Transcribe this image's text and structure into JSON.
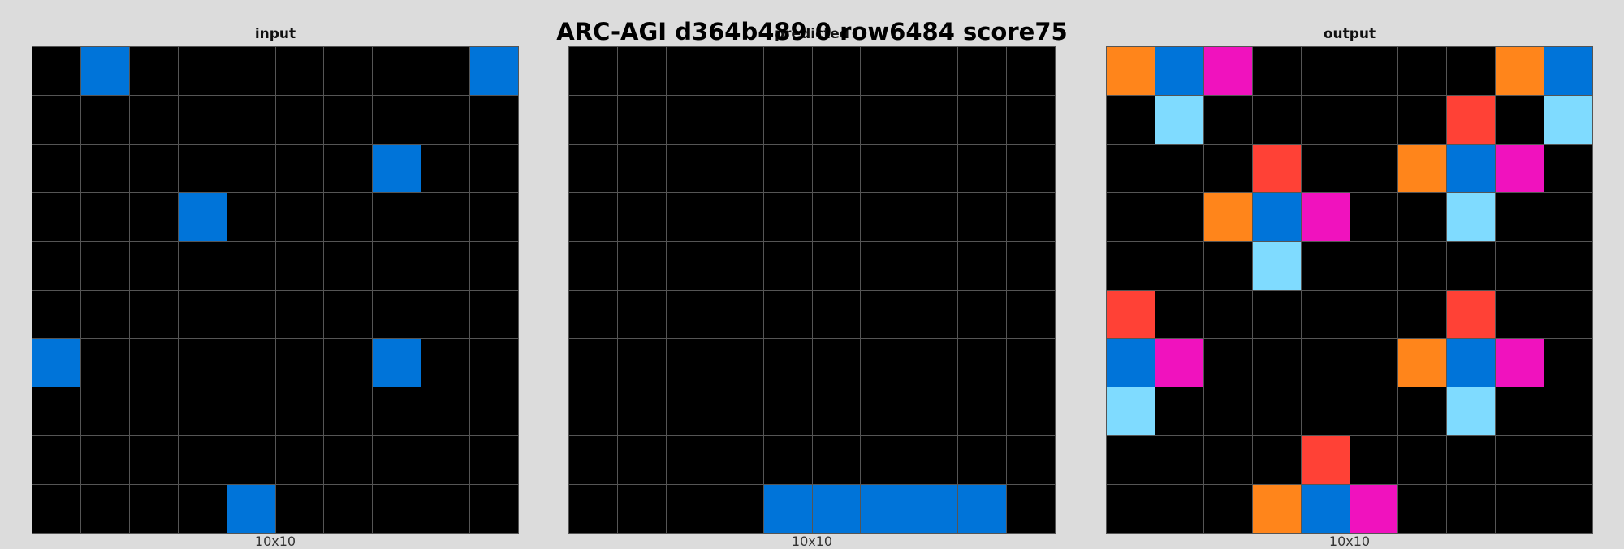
{
  "title": "ARC-AGI d364b489 0 row6484 score75",
  "palette": {
    "0": "#000000",
    "1": "#0074d9",
    "2": "#ff4136",
    "6": "#f012be",
    "7": "#ff851b",
    "8": "#7fdbff"
  },
  "panels": [
    {
      "label": "input",
      "size": "10x10",
      "grid": [
        [
          0,
          1,
          0,
          0,
          0,
          0,
          0,
          0,
          0,
          1
        ],
        [
          0,
          0,
          0,
          0,
          0,
          0,
          0,
          0,
          0,
          0
        ],
        [
          0,
          0,
          0,
          0,
          0,
          0,
          0,
          1,
          0,
          0
        ],
        [
          0,
          0,
          0,
          1,
          0,
          0,
          0,
          0,
          0,
          0
        ],
        [
          0,
          0,
          0,
          0,
          0,
          0,
          0,
          0,
          0,
          0
        ],
        [
          0,
          0,
          0,
          0,
          0,
          0,
          0,
          0,
          0,
          0
        ],
        [
          1,
          0,
          0,
          0,
          0,
          0,
          0,
          1,
          0,
          0
        ],
        [
          0,
          0,
          0,
          0,
          0,
          0,
          0,
          0,
          0,
          0
        ],
        [
          0,
          0,
          0,
          0,
          0,
          0,
          0,
          0,
          0,
          0
        ],
        [
          0,
          0,
          0,
          0,
          1,
          0,
          0,
          0,
          0,
          0
        ]
      ]
    },
    {
      "label": "predicted",
      "size": "10x10",
      "grid": [
        [
          0,
          0,
          0,
          0,
          0,
          0,
          0,
          0,
          0,
          0
        ],
        [
          0,
          0,
          0,
          0,
          0,
          0,
          0,
          0,
          0,
          0
        ],
        [
          0,
          0,
          0,
          0,
          0,
          0,
          0,
          0,
          0,
          0
        ],
        [
          0,
          0,
          0,
          0,
          0,
          0,
          0,
          0,
          0,
          0
        ],
        [
          0,
          0,
          0,
          0,
          0,
          0,
          0,
          0,
          0,
          0
        ],
        [
          0,
          0,
          0,
          0,
          0,
          0,
          0,
          0,
          0,
          0
        ],
        [
          0,
          0,
          0,
          0,
          0,
          0,
          0,
          0,
          0,
          0
        ],
        [
          0,
          0,
          0,
          0,
          0,
          0,
          0,
          0,
          0,
          0
        ],
        [
          0,
          0,
          0,
          0,
          0,
          0,
          0,
          0,
          0,
          0
        ],
        [
          0,
          0,
          0,
          0,
          1,
          1,
          1,
          1,
          1,
          0
        ]
      ]
    },
    {
      "label": "output",
      "size": "10x10",
      "grid": [
        [
          7,
          1,
          6,
          0,
          0,
          0,
          0,
          0,
          7,
          1
        ],
        [
          0,
          8,
          0,
          0,
          0,
          0,
          0,
          2,
          0,
          8
        ],
        [
          0,
          0,
          0,
          2,
          0,
          0,
          7,
          1,
          6,
          0
        ],
        [
          0,
          0,
          7,
          1,
          6,
          0,
          0,
          8,
          0,
          0
        ],
        [
          0,
          0,
          0,
          8,
          0,
          0,
          0,
          0,
          0,
          0
        ],
        [
          2,
          0,
          0,
          0,
          0,
          0,
          0,
          2,
          0,
          0
        ],
        [
          1,
          6,
          0,
          0,
          0,
          0,
          7,
          1,
          6,
          0
        ],
        [
          8,
          0,
          0,
          0,
          0,
          0,
          0,
          8,
          0,
          0
        ],
        [
          0,
          0,
          0,
          0,
          2,
          0,
          0,
          0,
          0,
          0
        ],
        [
          0,
          0,
          0,
          7,
          1,
          6,
          0,
          0,
          0,
          0
        ]
      ]
    }
  ]
}
